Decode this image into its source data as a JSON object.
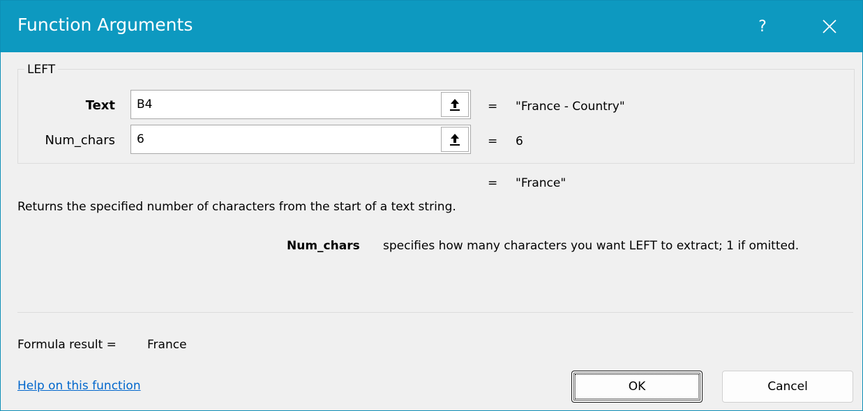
{
  "window": {
    "title": "Function Arguments",
    "help_glyph": "?",
    "close_icon": "close-icon",
    "accent_color": "#0d99c0"
  },
  "function": {
    "name": "LEFT",
    "arguments": [
      {
        "label": "Text",
        "bold": true,
        "input_value": "B4",
        "equals": "=",
        "evaluated": "\"France - Country\""
      },
      {
        "label": "Num_chars",
        "bold": false,
        "input_value": "6",
        "equals": "=",
        "evaluated": "6"
      }
    ],
    "result_equals": "=",
    "result_preview": "\"France\"",
    "description": "Returns the specified number of characters from the start of a text string.",
    "arg_help_name": "Num_chars",
    "arg_help_text": "specifies how many characters you want LEFT to extract; 1 if omitted."
  },
  "footer": {
    "formula_result_label": "Formula result =",
    "formula_result_value": "France",
    "help_link": "Help on this function",
    "ok_label": "OK",
    "cancel_label": "Cancel"
  }
}
